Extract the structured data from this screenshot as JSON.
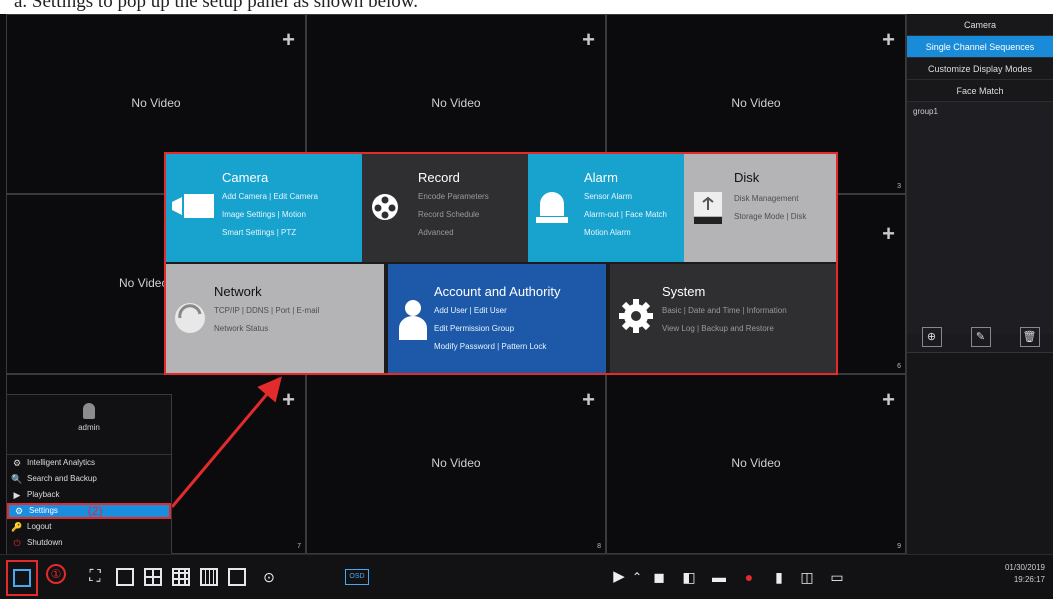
{
  "caption": "a.    Settings to pop up the setup panel as shown below.",
  "grid": {
    "no_video": "No Video",
    "channel_numbers": [
      "3",
      "6",
      "7",
      "8",
      "9"
    ]
  },
  "right_panel": {
    "tabs": [
      "Camera",
      "Single Channel Sequences",
      "Customize Display Modes",
      "Face Match"
    ],
    "group_item": "group1"
  },
  "settings": {
    "camera": {
      "title": "Camera",
      "lines": [
        "Add Camera | Edit Camera",
        "Image Settings | Motion",
        "Smart Settings | PTZ"
      ]
    },
    "record": {
      "title": "Record",
      "lines": [
        "Encode Parameters",
        "Record Schedule",
        "Advanced"
      ]
    },
    "alarm": {
      "title": "Alarm",
      "lines": [
        "Sensor Alarm",
        "Alarm-out | Face Match",
        "Motion Alarm"
      ]
    },
    "disk": {
      "title": "Disk",
      "lines": [
        "Disk Management",
        "Storage Mode | Disk"
      ]
    },
    "network": {
      "title": "Network",
      "lines": [
        "TCP/IP | DDNS | Port | E-mail",
        "Network Status"
      ]
    },
    "account": {
      "title": "Account and Authority",
      "lines": [
        "Add User | Edit User",
        "Edit Permission Group",
        "Modify Password | Pattern Lock"
      ]
    },
    "system": {
      "title": "System",
      "lines": [
        "Basic | Date and Time | Information",
        "View Log | Backup and Restore"
      ]
    }
  },
  "start_menu": {
    "user": "admin",
    "items": [
      "Intelligent Analytics",
      "Search and Backup",
      "Playback",
      "Settings",
      "Logout",
      "Shutdown"
    ],
    "callout": "(2)"
  },
  "taskbar": {
    "callout": "①",
    "osd_label": "OSD",
    "date": "01/30/2019",
    "time": "19:26:17"
  },
  "colors": {
    "highlight_red": "#e32b2b",
    "accent_blue": "#1a8bd8",
    "tile_blue": "#17a3cd",
    "tile_navy": "#1d59a8"
  }
}
